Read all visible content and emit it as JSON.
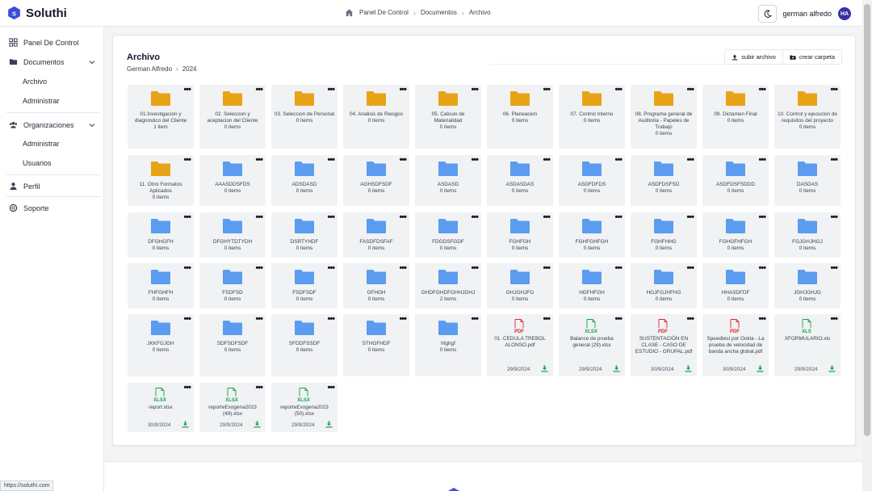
{
  "app": {
    "name": "Soluthi"
  },
  "breadcrumb": [
    "Panel De Control",
    "Documentos",
    "Archivo"
  ],
  "user": {
    "name": "german alfredo",
    "initials": "HA"
  },
  "sidebar": {
    "items": [
      {
        "label": "Panel De Control",
        "icon": "dashboard-icon"
      },
      {
        "label": "Documentos",
        "icon": "folder-icon",
        "sub": [
          "Archivo",
          "Administrar"
        ]
      },
      {
        "label": "Organizaciones",
        "icon": "users-icon",
        "sub": [
          "Administrar",
          "Usuarios"
        ]
      },
      {
        "label": "Perfil",
        "icon": "user-icon"
      },
      {
        "label": "Soporte",
        "icon": "lifebuoy-icon"
      }
    ]
  },
  "main": {
    "title": "Archivo",
    "path": [
      "German Alfredo",
      "2024"
    ],
    "upload_label": "subir archivo",
    "create_label": "crear carpeta"
  },
  "colors": {
    "folder_yellow": "#e8a317",
    "folder_blue": "#5b9cf0",
    "pdf": "#dc2626",
    "xlsx": "#16a34a",
    "download": "#16a34a"
  },
  "items": [
    {
      "name": "01.Investigacion y diagnostico del Cliente",
      "count": "1 item",
      "kind": "folder-yellow"
    },
    {
      "name": "02. Seleccion y aceptacion del Cliente",
      "count": "0 items",
      "kind": "folder-yellow"
    },
    {
      "name": "03. Seleccion de Personal",
      "count": "0 items",
      "kind": "folder-yellow"
    },
    {
      "name": "04. Analisis de Riesgos",
      "count": "0 items",
      "kind": "folder-yellow"
    },
    {
      "name": "05. Calculo de Materialidad",
      "count": "0 items",
      "kind": "folder-yellow"
    },
    {
      "name": "06. Planeacion",
      "count": "0 items",
      "kind": "folder-yellow"
    },
    {
      "name": "07. Control Interno",
      "count": "0 items",
      "kind": "folder-yellow"
    },
    {
      "name": "08. Programa general de Auditoria - Papeles de Trabajo",
      "count": "0 items",
      "kind": "folder-yellow"
    },
    {
      "name": "09. Dictamen Final",
      "count": "0 items",
      "kind": "folder-yellow"
    },
    {
      "name": "10. Control y ejecucion de requisitos del proyecto",
      "count": "0 items",
      "kind": "folder-yellow"
    },
    {
      "name": "11. Otroi Formatos Aplicados",
      "count": "0 items",
      "kind": "folder-yellow"
    },
    {
      "name": "AAASDDSFDS",
      "count": "0 items",
      "kind": "folder-blue"
    },
    {
      "name": "ADSDASD",
      "count": "0 items",
      "kind": "folder-blue"
    },
    {
      "name": "AGHSDFSDF",
      "count": "0 items",
      "kind": "folder-blue"
    },
    {
      "name": "ASDASD",
      "count": "0 items",
      "kind": "folder-blue"
    },
    {
      "name": "ASDASDAS",
      "count": "0 items",
      "kind": "folder-blue"
    },
    {
      "name": "ASDFDFDS",
      "count": "0 items",
      "kind": "folder-blue"
    },
    {
      "name": "ASDFDSFSD",
      "count": "0 items",
      "kind": "folder-blue"
    },
    {
      "name": "ASDFDSFSDDD",
      "count": "0 items",
      "kind": "folder-blue"
    },
    {
      "name": "DASDAS",
      "count": "0 items",
      "kind": "folder-blue"
    },
    {
      "name": "DFGHGFH",
      "count": "0 items",
      "kind": "folder-blue"
    },
    {
      "name": "DFGHYTDTYDH",
      "count": "0 items",
      "kind": "folder-blue"
    },
    {
      "name": "DSRTYHDF",
      "count": "0 items",
      "kind": "folder-blue"
    },
    {
      "name": "FASDFDSFAF",
      "count": "0 items",
      "kind": "folder-blue"
    },
    {
      "name": "FDGDSFGDF",
      "count": "0 items",
      "kind": "folder-blue"
    },
    {
      "name": "FGHFGH",
      "count": "0 items",
      "kind": "folder-blue"
    },
    {
      "name": "FGHFGHFGH",
      "count": "0 items",
      "kind": "folder-blue"
    },
    {
      "name": "FGHFHHG",
      "count": "0 items",
      "kind": "folder-blue"
    },
    {
      "name": "FGHGFHFGH",
      "count": "0 items",
      "kind": "folder-blue"
    },
    {
      "name": "FGJGHJHGJ",
      "count": "0 items",
      "kind": "folder-blue"
    },
    {
      "name": "FHFGHFH",
      "count": "0 items",
      "kind": "folder-blue"
    },
    {
      "name": "FSDFSD",
      "count": "0 items",
      "kind": "folder-blue"
    },
    {
      "name": "FSDFSDF",
      "count": "0 items",
      "kind": "folder-blue"
    },
    {
      "name": "GFHGH",
      "count": "0 items",
      "kind": "folder-blue"
    },
    {
      "name": "GHDFGHDFGHHJGHJ",
      "count": "2 items",
      "kind": "folder-blue"
    },
    {
      "name": "GHJGHJFG",
      "count": "0 items",
      "kind": "folder-blue"
    },
    {
      "name": "HGFHFGH",
      "count": "0 items",
      "kind": "folder-blue"
    },
    {
      "name": "HGJFGJHFHG",
      "count": "0 items",
      "kind": "folder-blue"
    },
    {
      "name": "HHASDFDF",
      "count": "0 items",
      "kind": "folder-blue"
    },
    {
      "name": "JGHJGHJG",
      "count": "0 items",
      "kind": "folder-blue"
    },
    {
      "name": "JKKFGJGH",
      "count": "0 items",
      "kind": "folder-blue"
    },
    {
      "name": "SDFSDFSDF",
      "count": "0 items",
      "kind": "folder-blue"
    },
    {
      "name": "SFDDFSSDF",
      "count": "0 items",
      "kind": "folder-blue"
    },
    {
      "name": "STHGFHDF",
      "count": "0 items",
      "kind": "folder-blue"
    },
    {
      "name": "hfghgf",
      "count": "0 items",
      "kind": "folder-blue"
    },
    {
      "name": "01. CEDULA TREBOL ALONSO.pdf",
      "date": "29/9/2024",
      "kind": "pdf",
      "badge": "PDF"
    },
    {
      "name": "Balance de prueba general (29).xlsx",
      "date": "29/9/2024",
      "kind": "xlsx",
      "badge": "XLSX"
    },
    {
      "name": "SUSTENTACIÓN EN CLASE - CASO DE ESTUDIO - GRUPAL.pdf",
      "date": "30/9/2024",
      "kind": "pdf",
      "badge": "PDF"
    },
    {
      "name": "Speedtest por Ookla - La prueba de velocidad de banda ancha global.pdf",
      "date": "30/9/2024",
      "kind": "pdf",
      "badge": "PDF"
    },
    {
      "name": "XFORMULARIO.xls",
      "date": "29/9/2024",
      "kind": "xlsx",
      "badge": "XLS"
    },
    {
      "name": "report.xlsx",
      "date": "30/9/2024",
      "kind": "xlsx",
      "badge": "XLSX"
    },
    {
      "name": "reporteExogena2023 (49).xlsx",
      "date": "29/9/2024",
      "kind": "xlsx",
      "badge": "XLSX"
    },
    {
      "name": "reporteExogena2023 (50).xlsx",
      "date": "29/9/2024",
      "kind": "xlsx",
      "badge": "XLSX"
    }
  ],
  "menu_glyph": "•••",
  "status_url": "https://soluthi.com"
}
